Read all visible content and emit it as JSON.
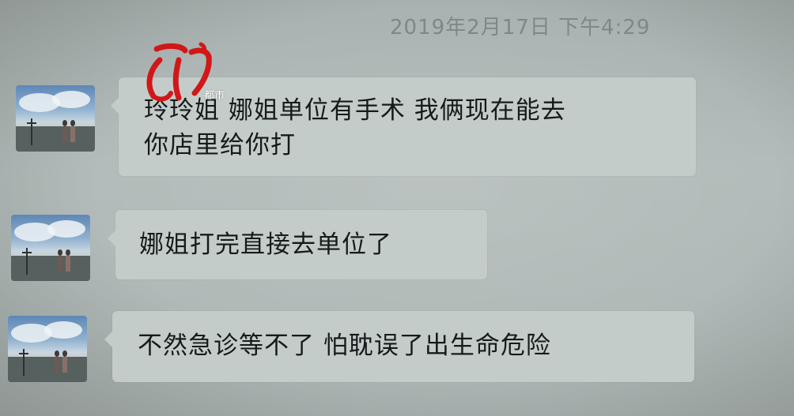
{
  "timestamp": "2019年2月17日 下午4:29",
  "logo": {
    "subtitle": "都市"
  },
  "messages": [
    {
      "sender_avatar_icon": "beach-figures-avatar-icon",
      "lines": [
        "玲玲姐 娜姐单位有手术 我俩现在能去",
        "你店里给你打"
      ]
    },
    {
      "sender_avatar_icon": "beach-figures-avatar-icon",
      "lines": [
        "娜姐打完直接去单位了"
      ]
    },
    {
      "sender_avatar_icon": "beach-figures-avatar-icon",
      "lines": [
        "不然急诊等不了 怕耽误了出生命危险"
      ]
    }
  ],
  "colors": {
    "background": "#aeb7b5",
    "bubble": "#c4ccca",
    "text": "#171a1a",
    "timestamp": "#7e8886",
    "logo_red": "#d01818"
  }
}
